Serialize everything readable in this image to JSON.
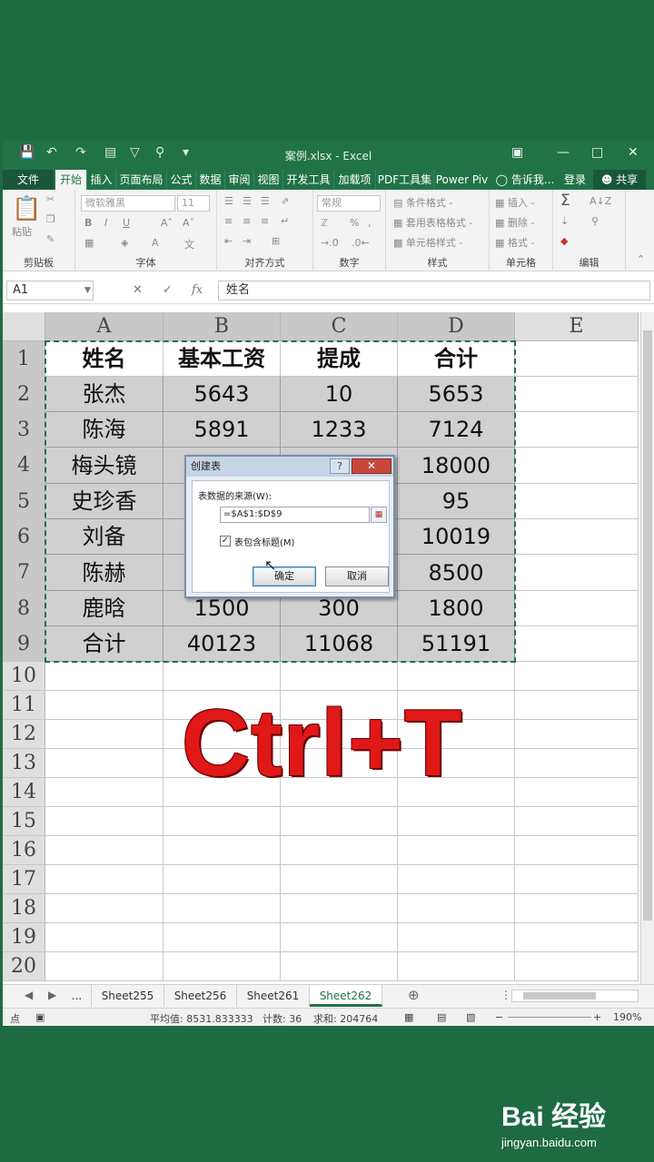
{
  "window": {
    "title": "案例.xlsx - Excel",
    "quick_access": [
      "save-icon",
      "undo-icon",
      "redo-icon",
      "form-icon",
      "filter-icon",
      "zoom-icon",
      "customize-icon"
    ],
    "controls": [
      "ribbon-options-icon",
      "minimize-icon",
      "maximize-icon",
      "close-icon"
    ]
  },
  "ribbon_tabs": [
    "文件",
    "开始",
    "插入",
    "页面布局",
    "公式",
    "数据",
    "审阅",
    "视图",
    "开发工具",
    "加载项",
    "PDF工具集",
    "Power Piv"
  ],
  "ribbon_right": {
    "tell_me": "告诉我...",
    "login": "登录",
    "share": "共享"
  },
  "ribbon_groups": {
    "clipboard": {
      "name": "剪贴板",
      "paste": "粘贴"
    },
    "font": {
      "name": "字体",
      "family": "微软雅黑",
      "size": "11"
    },
    "alignment": {
      "name": "对齐方式"
    },
    "number": {
      "name": "数字",
      "format": "常规"
    },
    "styles": {
      "name": "样式",
      "items": [
        "条件格式 -",
        "套用表格格式 -",
        "单元格样式 -"
      ]
    },
    "cells": {
      "name": "单元格",
      "items": [
        "插入 -",
        "删除 -",
        "格式 -"
      ]
    },
    "editing": {
      "name": "编辑"
    }
  },
  "formula_bar": {
    "name_box": "A1",
    "content": "姓名",
    "fx": "fx"
  },
  "grid": {
    "columns": [
      "A",
      "B",
      "C",
      "D",
      "E"
    ],
    "rows": [
      "1",
      "2",
      "3",
      "4",
      "5",
      "6",
      "7",
      "8",
      "9",
      "10",
      "11",
      "12",
      "13",
      "14",
      "15",
      "16",
      "17",
      "18",
      "19",
      "20"
    ],
    "cells": [
      [
        "姓名",
        "基本工资",
        "提成",
        "合计"
      ],
      [
        "张杰",
        "5643",
        "10",
        "5653"
      ],
      [
        "陈海",
        "5891",
        "1233",
        "7124"
      ],
      [
        "梅头镜",
        "",
        "",
        "18000"
      ],
      [
        "史珍香",
        "",
        "",
        "95"
      ],
      [
        "刘备",
        "",
        "",
        "10019"
      ],
      [
        "陈赫",
        "",
        "",
        "8500"
      ],
      [
        "鹿晗",
        "1500",
        "300",
        "1800"
      ],
      [
        "合计",
        "40123",
        "11068",
        "51191"
      ]
    ]
  },
  "dialog": {
    "title": "创建表",
    "help": "?",
    "close": "✕",
    "label": "表数据的来源(W):",
    "range": "=$A$1:$D$9",
    "checkbox_label": "表包含标题(M)",
    "checkbox_checked": true,
    "ok": "确定",
    "cancel": "取消"
  },
  "overlay_text": "Ctrl+T",
  "sheet_tabs": {
    "ellipsis": "...",
    "tabs": [
      "Sheet255",
      "Sheet256",
      "Sheet261",
      "Sheet262"
    ],
    "active": "Sheet262"
  },
  "status_bar": {
    "mode": "点",
    "average": "平均值: 8531.833333",
    "count": "计数: 36",
    "sum": "求和: 204764",
    "zoom": "190%"
  },
  "watermark": {
    "brand": "Bai 经验",
    "url": "jingyan.baidu.com"
  },
  "colors": {
    "excel_green": "#217346",
    "background": "#1e6b43",
    "overlay_red": "#e01818",
    "selection_gray": "#d0d0d0"
  }
}
